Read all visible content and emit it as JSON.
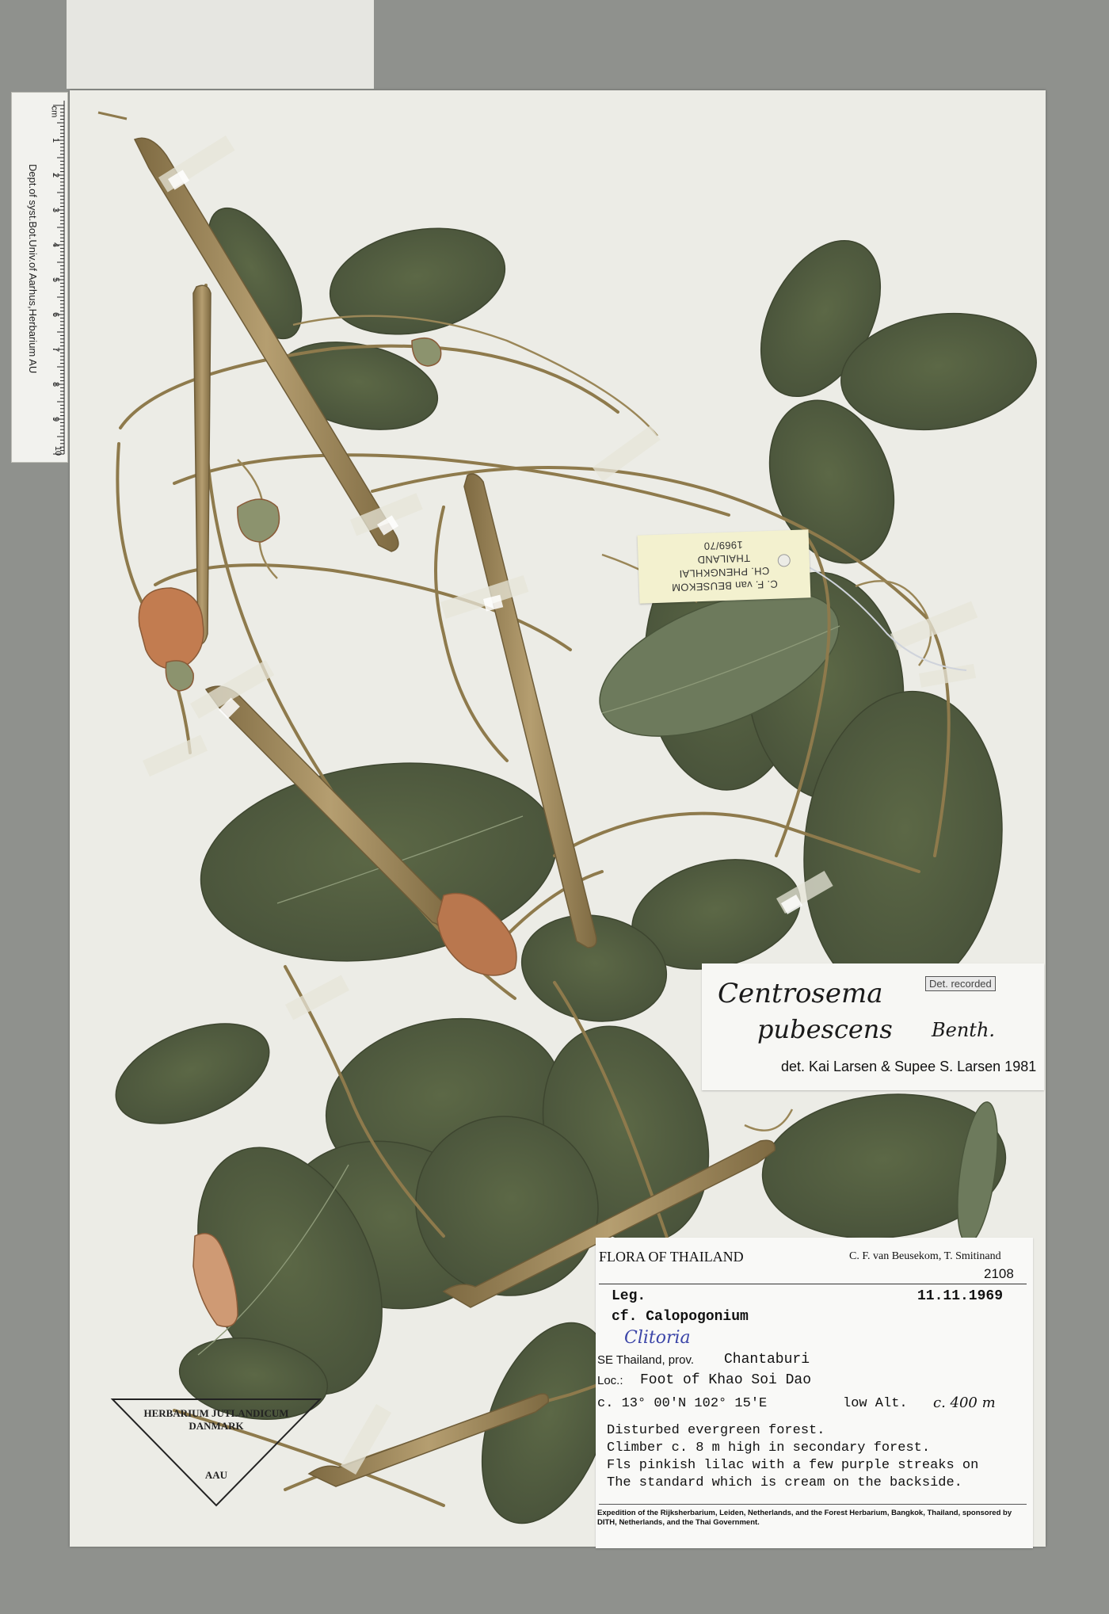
{
  "ruler": {
    "unit": "cm",
    "numbers": [
      "1",
      "2",
      "3",
      "4",
      "5",
      "6",
      "7",
      "8",
      "9",
      "10"
    ],
    "institution": "Dept.of syst.Bot.Univ.of Aarhus,Herbarium AU"
  },
  "collector_tag": {
    "line1": "C. F. van BEUSEKOM",
    "line2": "CH. PHENGKHLAI",
    "line3": "THAILAND",
    "line4": "1969/70"
  },
  "determination": {
    "genus": "Centrosema",
    "species": "pubescens",
    "author": "Benth.",
    "stamp": "Det. recorded",
    "by": "det. Kai Larsen & Supee S. Larsen 1981"
  },
  "label": {
    "flora": "FLORA OF THAILAND",
    "collectors": "C. F. van Beusekom, T. Smitinand",
    "number": "2108",
    "leg": "Leg.",
    "date": "11.11.1969",
    "prior_id": "cf. Calopogonium",
    "handwritten_id": "Clitoria",
    "region_label": "SE Thailand, prov.",
    "province": "Chantaburi",
    "loc_label": "Loc.:",
    "locality": "Foot of Khao Soi Dao",
    "coords": "c.  13°  00'N 102°  15'E",
    "alt_label": "low  Alt.",
    "altitude": "c. 400 m",
    "desc1": "Disturbed evergreen forest.",
    "desc2": "Climber c. 8 m high in secondary forest.",
    "desc3": "Fls pinkish lilac with a few purple streaks on",
    "desc4": "The standard which is cream on the backside.",
    "footer": "Expedition of the Rijksherbarium, Leiden, Netherlands, and the Forest Herbarium, Bangkok, Thailand, sponsored by DITH, Netherlands, and the Thai Government."
  },
  "herbarium_stamp": {
    "line1": "HERBARIUM JUTLANDICUM",
    "line2": "DANMARK",
    "code": "AAU"
  },
  "colors": {
    "background": "#8f918d",
    "sheet": "#ecece6",
    "leaf": "#4f5a3c",
    "stem": "#8e7a4c",
    "pod": "#a08a5c",
    "flower": "#c27c50",
    "tag": "#f3f1cf",
    "handwriting_blue": "#3c46a8"
  }
}
